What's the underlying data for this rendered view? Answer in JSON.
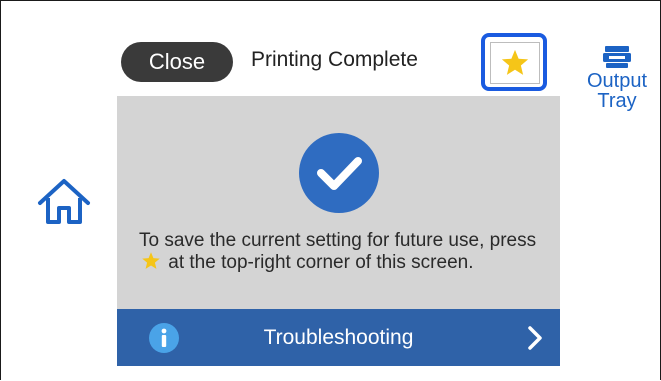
{
  "header": {
    "close_label": "Close",
    "title": "Printing Complete",
    "favorite_icon": "star-icon",
    "accent_color": "#1a5be0",
    "star_color": "#f5c518"
  },
  "side": {
    "home_icon": "home-icon",
    "output_tray": {
      "icon": "output-tray-icon",
      "line1": "Output",
      "line2": "Tray"
    }
  },
  "main": {
    "status_icon": "checkmark-icon",
    "message_part1": "To save the current setting for future use, press",
    "message_part2": "at the top-right corner of this screen.",
    "inline_icon": "star-icon"
  },
  "footer": {
    "info_icon": "info-icon",
    "label": "Troubleshooting",
    "chevron_icon": "chevron-right-icon",
    "bar_color": "#2f62a8"
  }
}
